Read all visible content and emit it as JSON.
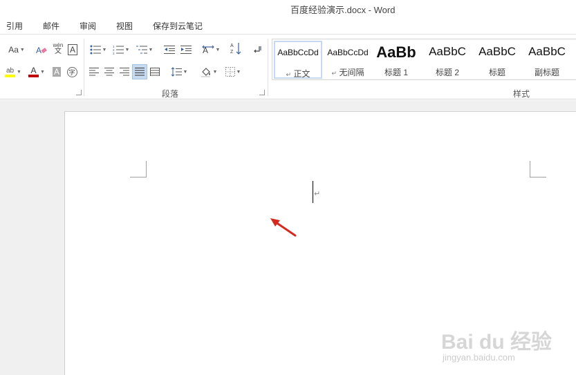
{
  "window": {
    "title": "百度经验演示.docx - Word"
  },
  "tabs": [
    "引用",
    "邮件",
    "审阅",
    "视图",
    "保存到云笔记"
  ],
  "font_group": {
    "font_size_btn": "Aa",
    "phonetic_btn": "wén",
    "border_char_btn": "A",
    "enclose_char_btn": "字",
    "shade_char_btn": "A",
    "font_color_btn": "A",
    "highlight_btn": "ab"
  },
  "paragraph_group": {
    "label": "段落"
  },
  "styles_group": {
    "label": "样式",
    "items": [
      {
        "preview": "AaBbCcDd",
        "name": "正文",
        "mark": "↵"
      },
      {
        "preview": "AaBbCcDd",
        "name": "无间隔",
        "mark": "↵"
      },
      {
        "preview": "AaBb",
        "name": "标题 1"
      },
      {
        "preview": "AaBbC",
        "name": "标题 2"
      },
      {
        "preview": "AaBbC",
        "name": "标题"
      },
      {
        "preview": "AaBbC",
        "name": "副标题"
      }
    ]
  },
  "document": {
    "paragraph_mark": "↵"
  },
  "watermark": {
    "main": "Bai du 经验",
    "sub": "jingyan.baidu.com"
  },
  "colors": {
    "highlight_yellow": "#ffff00",
    "font_red": "#c00000",
    "arrow_red": "#d42a1e",
    "selection_blue": "#c8daf0"
  }
}
